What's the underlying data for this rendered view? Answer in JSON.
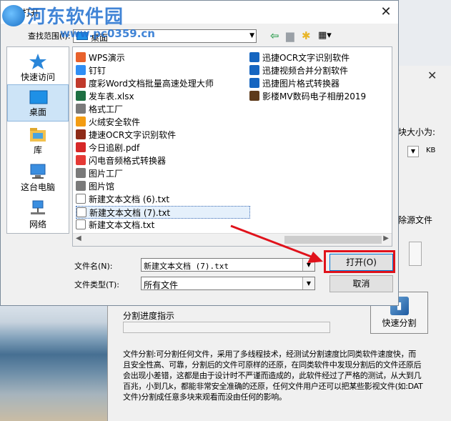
{
  "watermark": {
    "title": "河东软件园",
    "url": "www.pc0359.cn"
  },
  "dialog": {
    "title": "打开",
    "look_in_label": "查找范围(I):",
    "look_in_value": "桌面",
    "places": [
      {
        "label": "快速访问",
        "icon": "star-icon"
      },
      {
        "label": "桌面",
        "icon": "desktop-icon",
        "active": true
      },
      {
        "label": "库",
        "icon": "library-icon"
      },
      {
        "label": "这台电脑",
        "icon": "computer-icon"
      },
      {
        "label": "网络",
        "icon": "network-icon"
      }
    ],
    "files_col1": [
      {
        "name": "WPS演示",
        "icon": "wps-icon",
        "color": "#e8612c"
      },
      {
        "name": "钉钉",
        "icon": "dingtalk-icon",
        "color": "#2f8ef4"
      },
      {
        "name": "度彩Word文档批量高速处理大师",
        "icon": "word-tool-icon",
        "color": "#c0392b"
      },
      {
        "name": "发车表.xlsx",
        "icon": "excel-icon",
        "color": "#1d6f42"
      },
      {
        "name": "格式工厂",
        "icon": "format-factory-icon",
        "color": "#7a7a7a"
      },
      {
        "name": "火绒安全软件",
        "icon": "huorong-icon",
        "color": "#f39c12"
      },
      {
        "name": "捷速OCR文字识别软件",
        "icon": "ocr-icon",
        "color": "#8e2b18"
      },
      {
        "name": "今日追剧.pdf",
        "icon": "pdf-icon",
        "color": "#d62828"
      },
      {
        "name": "闪电音频格式转换器",
        "icon": "audio-icon",
        "color": "#e53935"
      },
      {
        "name": "图片工厂",
        "icon": "image-factory-icon",
        "color": "#7a7a7a"
      },
      {
        "name": "图片馆",
        "icon": "image-gallery-icon",
        "color": "#7a7a7a"
      },
      {
        "name": "新建文本文档 (6).txt",
        "icon": "txt-icon"
      },
      {
        "name": "新建文本文档 (7).txt",
        "icon": "txt-icon",
        "selected": true
      },
      {
        "name": "新建文本文档.txt",
        "icon": "txt-icon"
      }
    ],
    "files_col2": [
      {
        "name": "迅捷OCR文字识别软件",
        "icon": "xunjie-ocr-icon",
        "color": "#1565c0"
      },
      {
        "name": "迅捷视频合并分割软件",
        "icon": "xunjie-video-icon",
        "color": "#1565c0"
      },
      {
        "name": "迅捷图片格式转换器",
        "icon": "xunjie-image-icon",
        "color": "#1565c0"
      },
      {
        "name": "影楼MV数码电子相册2019",
        "icon": "album-icon",
        "color": "#5d3a1a"
      }
    ],
    "file_name_label": "文件名(N):",
    "file_name_value": "新建文本文档 (7).txt",
    "file_type_label": "文件类型(T):",
    "file_type_value": "所有文件",
    "open_label": "打开(O)",
    "cancel_label": "取消"
  },
  "background_app": {
    "block_size_label": "块大小为:",
    "unit": "KB",
    "delete_source": "除源文件",
    "progress_label": "分割进度指示",
    "split_button": "快速分割",
    "description": "文件分割:可分割任何文件，采用了多线程技术，经测试分割速度比同类软件速度快，而且安全性高、可靠，分割后的文件可原样的还原，在同类软件中发现分割后的文件还原后会出现小差错，这都是由于设计时不严谨而造成的，此软件经过了严格的测试，从大到几百兆，小到几k，都能非常安全准确的还原，任何文件用户还可以把某些影视文件(如:DAT文件)分割成任意多块来观看而没由任何的影响。"
  },
  "colors": {
    "highlight": "#e0121b",
    "accent": "#0078d7"
  }
}
